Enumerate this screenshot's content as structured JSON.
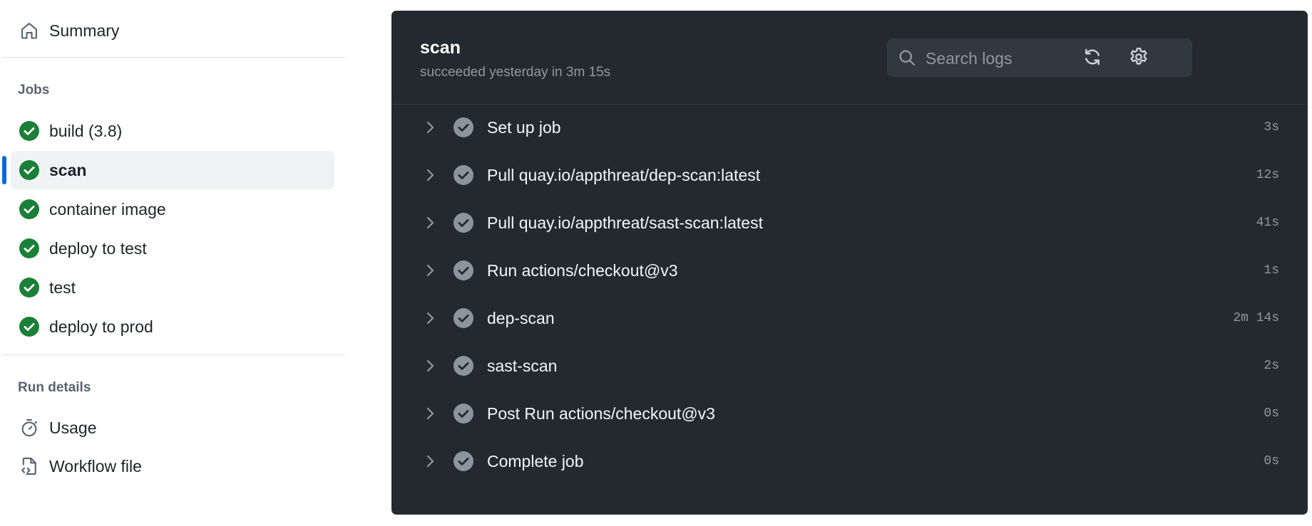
{
  "sidebar": {
    "summary_label": "Summary",
    "jobs_heading": "Jobs",
    "jobs": [
      {
        "label": "build (3.8)",
        "status": "success"
      },
      {
        "label": "scan",
        "status": "success",
        "selected": true
      },
      {
        "label": "container image",
        "status": "success"
      },
      {
        "label": "deploy to test",
        "status": "success"
      },
      {
        "label": "test",
        "status": "success"
      },
      {
        "label": "deploy to prod",
        "status": "success"
      }
    ],
    "run_details_heading": "Run details",
    "usage_label": "Usage",
    "workflow_file_label": "Workflow file"
  },
  "panel": {
    "title": "scan",
    "status": "succeeded yesterday in 3m 15s",
    "search": {
      "placeholder": "Search logs",
      "value": ""
    },
    "steps": [
      {
        "name": "Set up job",
        "duration": "3s"
      },
      {
        "name": "Pull quay.io/appthreat/dep-scan:latest",
        "duration": "12s"
      },
      {
        "name": "Pull quay.io/appthreat/sast-scan:latest",
        "duration": "41s"
      },
      {
        "name": "Run actions/checkout@v3",
        "duration": "1s"
      },
      {
        "name": "dep-scan",
        "duration": "2m 14s"
      },
      {
        "name": "sast-scan",
        "duration": "2s"
      },
      {
        "name": "Post Run actions/checkout@v3",
        "duration": "0s"
      },
      {
        "name": "Complete job",
        "duration": "0s"
      }
    ]
  },
  "colors": {
    "success_green": "#1a7f37",
    "selected_accent": "#0969da",
    "panel_bg": "#24292f",
    "step_check_grey": "#8c959f"
  }
}
